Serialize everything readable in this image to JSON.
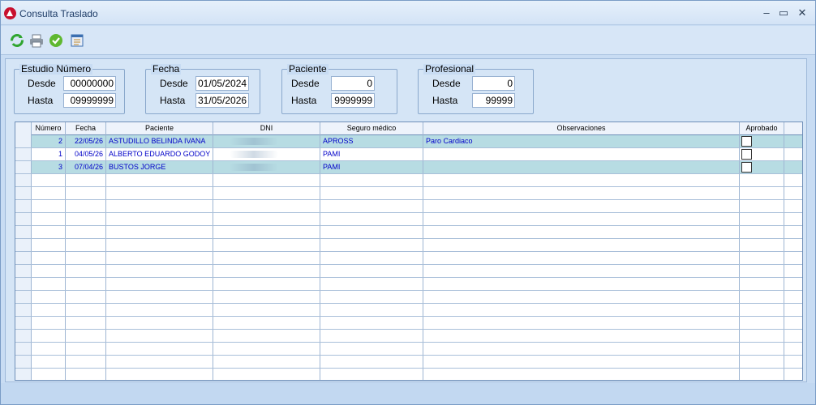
{
  "window": {
    "title": "Consulta Traslado",
    "controls": {
      "minimize": "–",
      "maximize": "▭",
      "close": "✕"
    }
  },
  "toolbar": {
    "buttons": [
      {
        "icon": "refresh-icon",
        "color": "#2fa52f"
      },
      {
        "icon": "print-icon",
        "color": "#6f7b88"
      },
      {
        "icon": "approve-icon",
        "color": "#5fb830"
      },
      {
        "icon": "report-icon",
        "color": "#3b6fb0"
      }
    ]
  },
  "filters": {
    "estudio": {
      "title": "Estudio Número",
      "desde_label": "Desde",
      "desde": "00000000",
      "hasta_label": "Hasta",
      "hasta": "09999999"
    },
    "fecha": {
      "title": "Fecha",
      "desde_label": "Desde",
      "desde": "01/05/2024",
      "hasta_label": "Hasta",
      "hasta": "31/05/2026"
    },
    "paciente": {
      "title": "Paciente",
      "desde_label": "Desde",
      "desde": "0",
      "hasta_label": "Hasta",
      "hasta": "9999999"
    },
    "profesional": {
      "title": "Profesional",
      "desde_label": "Desde",
      "desde": "0",
      "hasta_label": "Hasta",
      "hasta": "99999"
    }
  },
  "grid": {
    "headers": [
      "Número",
      "Fecha",
      "Paciente",
      "DNI",
      "Seguro médico",
      "Observaciones",
      "Aprobado"
    ],
    "rows": [
      {
        "numero": "2",
        "fecha": "22/05/26",
        "paciente": "ASTUDILLO BELINDA IVANA",
        "dni": "",
        "seguro": "APROSS",
        "observaciones": "Paro Cardiaco",
        "aprobado": false,
        "selected": true
      },
      {
        "numero": "1",
        "fecha": "04/05/26",
        "paciente": "ALBERTO EDUARDO GODOY",
        "dni": "",
        "seguro": "PAMI",
        "observaciones": "",
        "aprobado": false,
        "selected": false
      },
      {
        "numero": "3",
        "fecha": "07/04/26",
        "paciente": "BUSTOS JORGE",
        "dni": "",
        "seguro": "PAMI",
        "observaciones": "",
        "aprobado": false,
        "selected": true
      }
    ]
  },
  "colors": {
    "accent": "#0000c8",
    "selected_row": "#b7dce3"
  }
}
